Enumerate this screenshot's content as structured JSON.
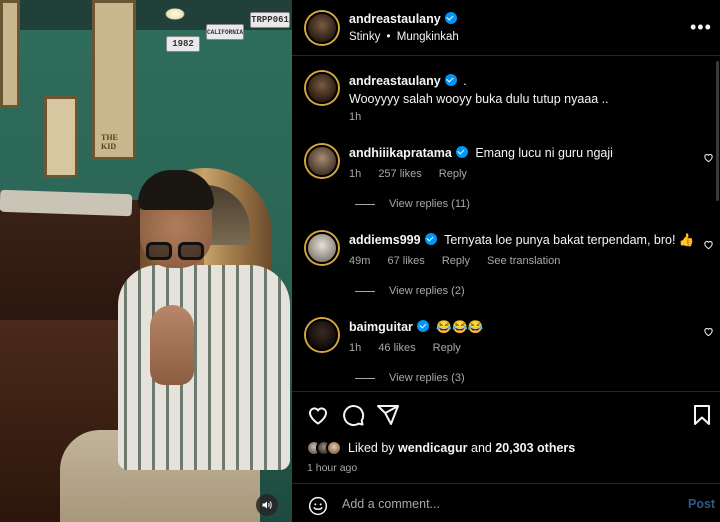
{
  "post": {
    "author": {
      "username": "andreastaulany",
      "verified": true
    },
    "music": {
      "title": "Stinky",
      "separator": "•",
      "artist": "Mungkinkah"
    },
    "caption": {
      "username": "andreastaulany",
      "suffix": ".",
      "text": "Wooyyyy salah wooyy buka dulu tutup nyaaa ..",
      "time": "1h"
    }
  },
  "comments": [
    {
      "username": "andhiiikapratama",
      "verified": true,
      "text": "Emang lucu ni guru ngaji",
      "time": "1h",
      "likes": "257 likes",
      "reply": "Reply",
      "extra": "",
      "view_replies": "View replies (11)"
    },
    {
      "username": "addiems999",
      "verified": true,
      "text": "Ternyata loe punya bakat terpendam, bro! 👍",
      "time": "49m",
      "likes": "67 likes",
      "reply": "Reply",
      "extra": "See translation",
      "view_replies": "View replies (2)"
    },
    {
      "username": "baimguitar",
      "verified": true,
      "text": "😂😂😂",
      "time": "1h",
      "likes": "46 likes",
      "reply": "Reply",
      "extra": "",
      "view_replies": "View replies (3)"
    }
  ],
  "likes": {
    "prefix": "Liked by",
    "user": "wendicagur",
    "conj": "and",
    "others": "20,303 others"
  },
  "posted_ago": "1 hour ago",
  "composer": {
    "placeholder": "Add a comment...",
    "post_label": "Post"
  },
  "icons": {
    "more": "more-options-icon",
    "like": "heart-icon",
    "comment": "comment-icon",
    "share": "share-icon",
    "save": "bookmark-icon",
    "emoji": "emoji-icon",
    "sound": "speaker-icon"
  },
  "colors": {
    "background": "#000000",
    "verified": "#0095f6",
    "muted_text": "#a8a8a8",
    "post_disabled": "#2b5a86"
  },
  "media_text": {
    "plates": [
      "TRPP061",
      "CALIFORNIA",
      "1982"
    ],
    "poster_caption": "THE KID"
  }
}
